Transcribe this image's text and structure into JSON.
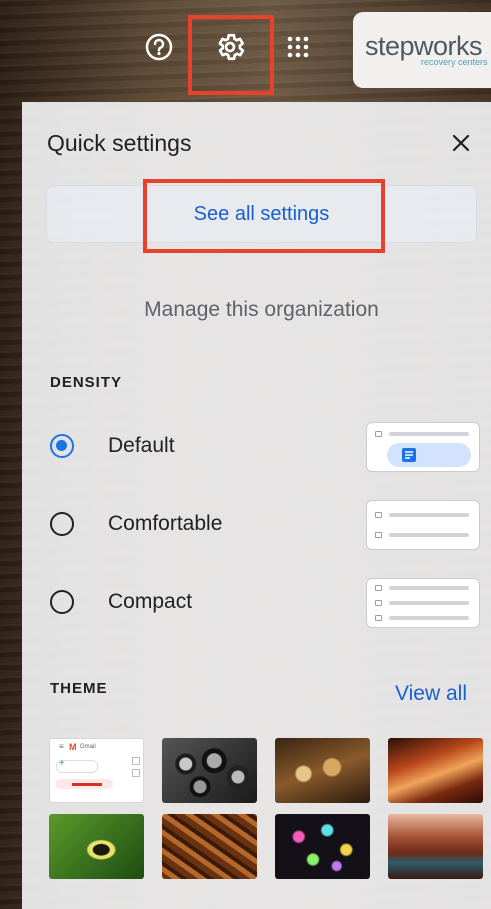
{
  "topbar": {
    "help_icon": "help-circle-icon",
    "gear_icon": "gear-icon",
    "apps_icon": "apps-grid-icon",
    "logo": {
      "word": "stepworks",
      "sub": "recovery centers"
    }
  },
  "panel": {
    "title": "Quick settings",
    "close_icon": "close-icon",
    "see_all_label": "See all settings",
    "manage_label": "Manage this organization"
  },
  "density": {
    "label": "DENSITY",
    "options": [
      {
        "label": "Default",
        "checked": true
      },
      {
        "label": "Comfortable",
        "checked": false
      },
      {
        "label": "Compact",
        "checked": false
      }
    ]
  },
  "theme": {
    "label": "THEME",
    "view_all": "View all",
    "gmail_thumb": {
      "menu": "≡",
      "brand": "Gmail"
    },
    "thumbs": [
      "Default Gmail",
      "Pipes",
      "Chess",
      "Canyon",
      "Caterpillar",
      "Autumn leaves",
      "Bokeh lights",
      "Canyon river"
    ]
  },
  "colors": {
    "accent": "#1a73e8",
    "highlight": "#e8412c",
    "link": "#1a5fcf"
  }
}
